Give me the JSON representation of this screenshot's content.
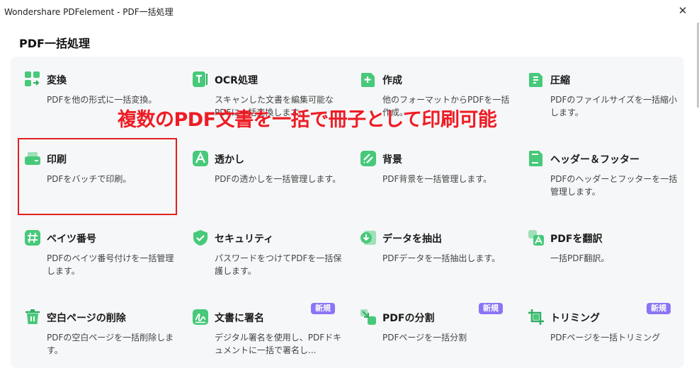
{
  "window": {
    "title": "Wondershare PDFelement - PDF一括処理",
    "close_glyph": "✕"
  },
  "page": {
    "heading": "PDF一括処理"
  },
  "cards": [
    {
      "title": "変換",
      "desc": "PDFを他の形式に一括変換。",
      "icon": "convert-icon"
    },
    {
      "title": "OCR処理",
      "desc": "スキャンした文書を編集可能なPDFに一括変換します。",
      "icon": "ocr-icon"
    },
    {
      "title": "作成",
      "desc": "他のフォーマットからPDFを一括作成。",
      "icon": "create-icon"
    },
    {
      "title": "圧縮",
      "desc": "PDFのファイルサイズを一括縮小します。",
      "icon": "compress-icon"
    },
    {
      "title": "印刷",
      "desc": "PDFをバッチで印刷。",
      "icon": "print-icon"
    },
    {
      "title": "透かし",
      "desc": "PDFの透かしを一括管理します。",
      "icon": "watermark-icon"
    },
    {
      "title": "背景",
      "desc": "PDF背景を一括管理します。",
      "icon": "background-icon"
    },
    {
      "title": "ヘッダー＆フッター",
      "desc": "PDFのヘッダーとフッターを一括管理します。",
      "icon": "header-footer-icon"
    },
    {
      "title": "ベイツ番号",
      "desc": "PDFのベイツ番号付けを一括管理します。",
      "icon": "bates-number-icon"
    },
    {
      "title": "セキュリティ",
      "desc": "パスワードをつけてPDFを一括保護します。",
      "icon": "security-icon"
    },
    {
      "title": "データを抽出",
      "desc": "PDFデータを一括抽出します。",
      "icon": "extract-data-icon"
    },
    {
      "title": "PDFを翻訳",
      "desc": "一括PDF翻訳。",
      "icon": "translate-icon"
    },
    {
      "title": "空白ページの削除",
      "desc": "PDFの空白ページを一括削除します。",
      "icon": "delete-blank-icon"
    },
    {
      "title": "文書に署名",
      "desc": "デジタル署名を使用し、PDFドキュメントに一括で署名し...",
      "icon": "sign-icon",
      "badge": "新規"
    },
    {
      "title": "PDFの分割",
      "desc": "PDFページを一括分割",
      "icon": "split-icon",
      "badge": "新規"
    },
    {
      "title": "トリミング",
      "desc": "PDFページを一括トリミング",
      "icon": "crop-icon",
      "badge": "新規"
    }
  ],
  "annotation": {
    "text": "複数のPDF文書を一括で冊子として印刷可能"
  },
  "colors": {
    "icon_green": "#47c97a",
    "icon_green_dark": "#2fae62",
    "badge": "#8b74f5",
    "annotation_red": "#ee1c24"
  }
}
